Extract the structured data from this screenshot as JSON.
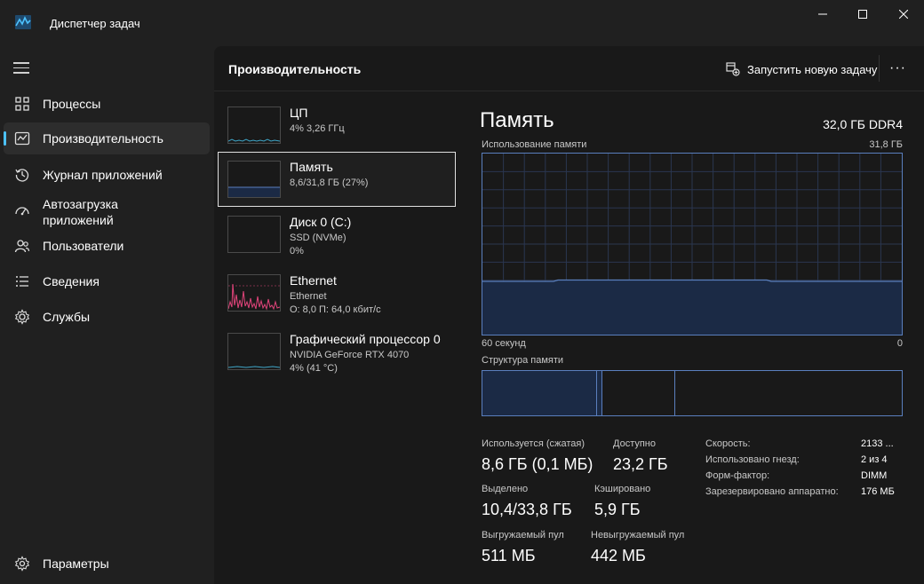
{
  "window": {
    "title": "Диспетчер задач",
    "controls": [
      "minimize-icon",
      "maximize-icon",
      "close-icon"
    ]
  },
  "sidebar": {
    "items": [
      {
        "label": "Процессы",
        "icon": "processes-icon",
        "active": false
      },
      {
        "label": "Производительность",
        "icon": "performance-icon",
        "active": true
      },
      {
        "label": "Журнал приложений",
        "icon": "app-history-icon",
        "active": false
      },
      {
        "label_line1": "Автозагрузка",
        "label_line2": "приложений",
        "icon": "startup-icon",
        "active": false
      },
      {
        "label": "Пользователи",
        "icon": "users-icon",
        "active": false
      },
      {
        "label": "Сведения",
        "icon": "details-icon",
        "active": false
      },
      {
        "label": "Службы",
        "icon": "services-icon",
        "active": false
      }
    ],
    "settings_label": "Параметры"
  },
  "header": {
    "title": "Производительность",
    "run_task_label": "Запустить новую задачу",
    "more_label": "···"
  },
  "resources": [
    {
      "name": "ЦП",
      "line1": "4%  3,26 ГГц",
      "line2": ""
    },
    {
      "name": "Память",
      "line1": "8,6/31,8 ГБ (27%)",
      "line2": ""
    },
    {
      "name": "Диск 0 (C:)",
      "line1": "SSD (NVMe)",
      "line2": "0%"
    },
    {
      "name": "Ethernet",
      "line1": "Ethernet",
      "line2": "О: 8,0 П: 64,0 кбит/с"
    },
    {
      "name": "Графический процессор 0",
      "line1": "NVIDIA GeForce RTX 4070",
      "line2": "4% (41 °C)"
    }
  ],
  "detail": {
    "title": "Память",
    "spec": "32,0 ГБ DDR4",
    "usage_label": "Использование памяти",
    "usage_max": "31,8 ГБ",
    "time_left": "60 секунд",
    "time_right": "0",
    "usage_fraction": 0.27,
    "composition_label": "Структура памяти",
    "stats": {
      "in_use_label": "Используется (сжатая)",
      "in_use_value": "8,6 ГБ (0,1 МБ)",
      "available_label": "Доступно",
      "available_value": "23,2 ГБ",
      "committed_label": "Выделено",
      "committed_value": "10,4/33,8 ГБ",
      "cached_label": "Кэшировано",
      "cached_value": "5,9 ГБ",
      "paged_label": "Выгружаемый пул",
      "paged_value": "511 МБ",
      "nonpaged_label": "Невыгружаемый пул",
      "nonpaged_value": "442 МБ"
    },
    "specs": [
      {
        "label": "Скорость:",
        "value": "2133 ..."
      },
      {
        "label": "Использовано гнезд:",
        "value": "2 из 4"
      },
      {
        "label": "Форм-фактор:",
        "value": "DIMM"
      },
      {
        "label": "Зарезервировано аппаратно:",
        "value": "176 МБ"
      }
    ]
  },
  "colors": {
    "accent": "#4cc2ff",
    "memory_line": "#5a7fbe",
    "memory_fill": "#1b2a45",
    "cpu_line": "#3fa6c8",
    "ethernet_line": "#e0447a"
  }
}
